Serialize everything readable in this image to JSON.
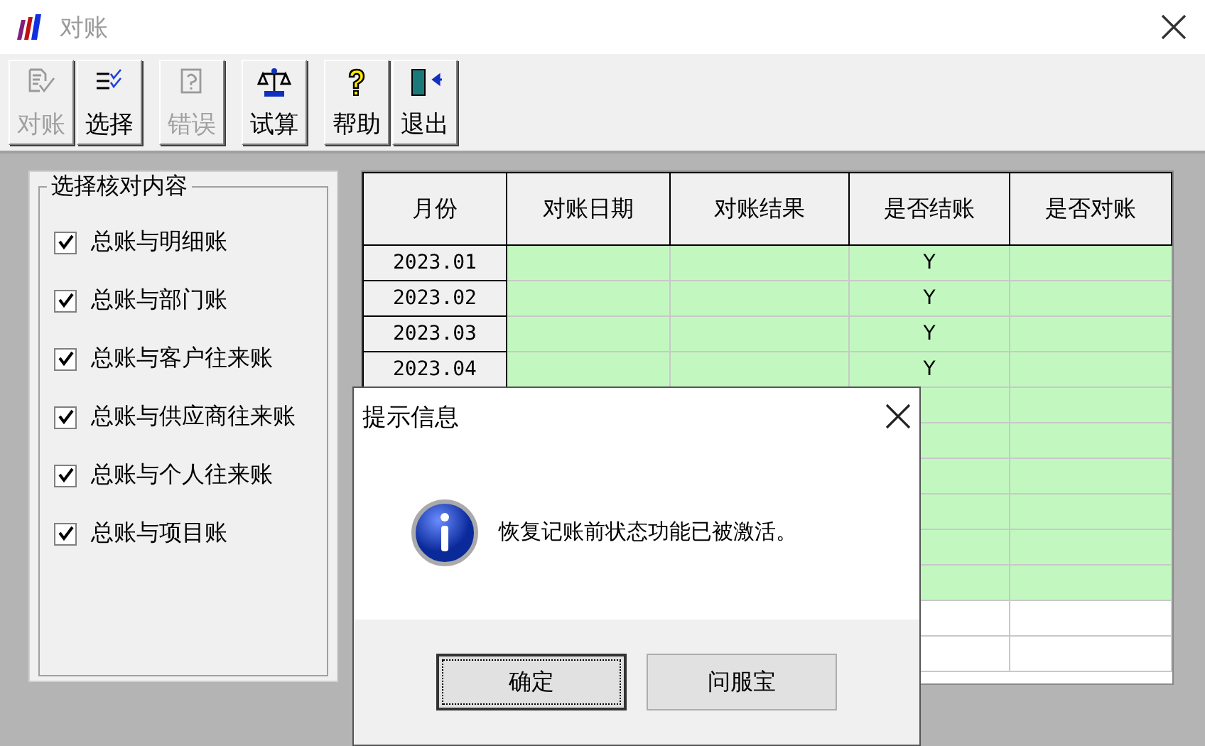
{
  "window": {
    "title": "对账",
    "active": false
  },
  "toolbar": {
    "groups": [
      [
        {
          "label": "对账",
          "kind": "check",
          "disabled": true
        },
        {
          "label": "选择",
          "kind": "select",
          "disabled": false
        }
      ],
      [
        {
          "label": "错误",
          "kind": "error",
          "disabled": true
        }
      ],
      [
        {
          "label": "试算",
          "kind": "trial",
          "disabled": false
        }
      ],
      [
        {
          "label": "帮助",
          "kind": "help",
          "disabled": false
        },
        {
          "label": "退出",
          "kind": "exit",
          "disabled": false
        }
      ]
    ]
  },
  "options": {
    "title": "选择核对内容",
    "items": [
      {
        "label": "总账与明细账",
        "checked": true
      },
      {
        "label": "总账与部门账",
        "checked": true
      },
      {
        "label": "总账与客户往来账",
        "checked": true
      },
      {
        "label": "总账与供应商往来账",
        "checked": true
      },
      {
        "label": "总账与个人往来账",
        "checked": true
      },
      {
        "label": "总账与项目账",
        "checked": true
      }
    ]
  },
  "table": {
    "columns": [
      "月份",
      "对账日期",
      "对账结果",
      "是否结账",
      "是否对账"
    ],
    "rows": [
      {
        "month": "2023.01",
        "closed": "Y",
        "highlighted": true
      },
      {
        "month": "2023.02",
        "closed": "Y",
        "highlighted": true
      },
      {
        "month": "2023.03",
        "closed": "Y",
        "highlighted": true
      },
      {
        "month": "2023.04",
        "closed": "Y",
        "highlighted": true
      },
      {
        "highlighted": true
      },
      {
        "highlighted": true
      },
      {
        "highlighted": true
      },
      {
        "highlighted": true
      },
      {
        "highlighted": true
      },
      {
        "highlighted": true
      },
      {
        "highlighted": false
      },
      {
        "highlighted": false
      }
    ]
  },
  "dialog": {
    "title": "提示信息",
    "kind": "info",
    "message": "恢复记账前状态功能已被激活。",
    "buttons": [
      {
        "label": "确定",
        "default": true
      },
      {
        "label": "问服宝",
        "default": false
      }
    ]
  }
}
